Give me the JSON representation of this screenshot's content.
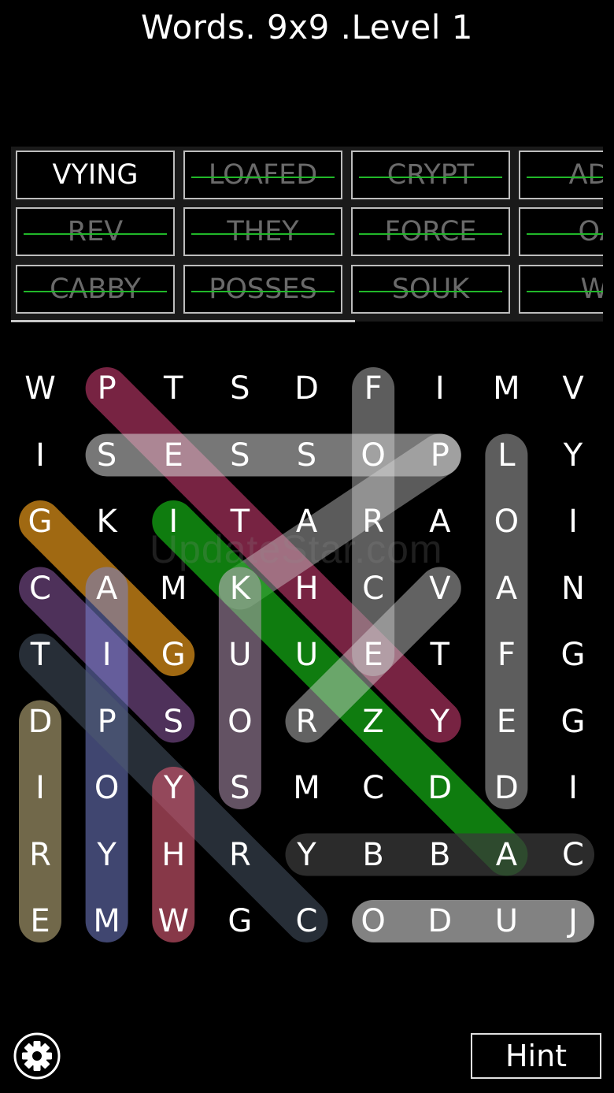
{
  "header": {
    "title": "Words. 9x9 .Level 1"
  },
  "word_bank": [
    {
      "label": "VYING",
      "found": false
    },
    {
      "label": "LOAFED",
      "found": true
    },
    {
      "label": "CRYPT",
      "found": true
    },
    {
      "label": "ADZ",
      "found": true
    },
    {
      "label": "REV",
      "found": true
    },
    {
      "label": "THEY",
      "found": true
    },
    {
      "label": "FORCE",
      "found": true
    },
    {
      "label": "OA",
      "found": true
    },
    {
      "label": "CABBY",
      "found": true
    },
    {
      "label": "POSSES",
      "found": true
    },
    {
      "label": "SOUK",
      "found": true
    },
    {
      "label": "WI",
      "found": true
    }
  ],
  "grid": {
    "rows": [
      [
        "W",
        "P",
        "T",
        "S",
        "D",
        "F",
        "I",
        "M",
        "V"
      ],
      [
        "I",
        "S",
        "E",
        "S",
        "S",
        "O",
        "P",
        "L",
        "Y"
      ],
      [
        "G",
        "K",
        "I",
        "T",
        "A",
        "R",
        "A",
        "O",
        "I"
      ],
      [
        "C",
        "A",
        "M",
        "K",
        "H",
        "C",
        "V",
        "A",
        "N"
      ],
      [
        "T",
        "I",
        "G",
        "U",
        "U",
        "E",
        "T",
        "F",
        "G"
      ],
      [
        "D",
        "P",
        "S",
        "O",
        "R",
        "Z",
        "Y",
        "E",
        "G"
      ],
      [
        "I",
        "O",
        "Y",
        "S",
        "M",
        "C",
        "D",
        "D",
        "I"
      ],
      [
        "R",
        "Y",
        "H",
        "R",
        "Y",
        "B",
        "B",
        "A",
        "C"
      ],
      [
        "E",
        "M",
        "W",
        "G",
        "C",
        "O",
        "D",
        "U",
        "J"
      ]
    ]
  },
  "highlights": [
    {
      "from": [
        0,
        1
      ],
      "to": [
        5,
        6
      ],
      "color": "#c0386a",
      "opacity": 0.62
    },
    {
      "from": [
        0,
        5
      ],
      "to": [
        4,
        5
      ],
      "color": "#a9a9a9",
      "opacity": 0.55
    },
    {
      "from": [
        1,
        1
      ],
      "to": [
        1,
        6
      ],
      "color": "#d9d9d9",
      "opacity": 0.55
    },
    {
      "from": [
        1,
        7
      ],
      "to": [
        6,
        7
      ],
      "color": "#a9a9a9",
      "opacity": 0.55
    },
    {
      "from": [
        1,
        6
      ],
      "to": [
        3,
        3
      ],
      "color": "#d9d9d9",
      "opacity": 0.42
    },
    {
      "from": [
        2,
        0
      ],
      "to": [
        4,
        2
      ],
      "color": "#e4961a",
      "opacity": 0.7
    },
    {
      "from": [
        2,
        2
      ],
      "to": [
        7,
        7
      ],
      "color": "#15b015",
      "opacity": 0.7
    },
    {
      "from": [
        3,
        0
      ],
      "to": [
        5,
        2
      ],
      "color": "#7e4f92",
      "opacity": 0.62
    },
    {
      "from": [
        3,
        1
      ],
      "to": [
        8,
        1
      ],
      "color": "#7b86d6",
      "opacity": 0.52
    },
    {
      "from": [
        3,
        3
      ],
      "to": [
        6,
        3
      ],
      "color": "#c5a3c5",
      "opacity": 0.5
    },
    {
      "from": [
        3,
        6
      ],
      "to": [
        5,
        4
      ],
      "color": "#d9d9d9",
      "opacity": 0.45
    },
    {
      "from": [
        4,
        0
      ],
      "to": [
        8,
        4
      ],
      "color": "#4e5b6e",
      "opacity": 0.5
    },
    {
      "from": [
        5,
        0
      ],
      "to": [
        8,
        0
      ],
      "color": "#cdbd86",
      "opacity": 0.55
    },
    {
      "from": [
        6,
        2
      ],
      "to": [
        8,
        2
      ],
      "color": "#d0566e",
      "opacity": 0.65
    },
    {
      "from": [
        7,
        4
      ],
      "to": [
        7,
        8
      ],
      "color": "#3a3a3a",
      "opacity": 0.75
    },
    {
      "from": [
        8,
        5
      ],
      "to": [
        8,
        8
      ],
      "color": "#d9d9d9",
      "opacity": 0.6
    }
  ],
  "watermark": "UpdateStar.com",
  "footer": {
    "hint_label": "Hint",
    "settings_icon": "gear-icon"
  }
}
